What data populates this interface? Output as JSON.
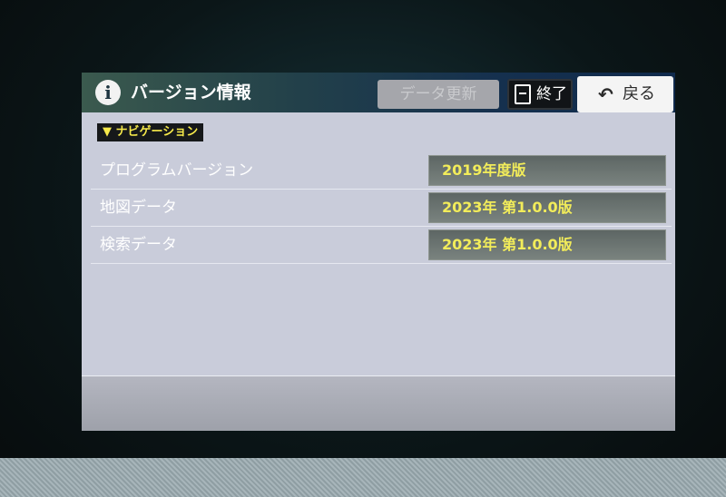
{
  "header": {
    "title": "バージョン情報",
    "info_icon": "info-icon",
    "update_button": "データ更新",
    "end_button": "終了",
    "end_icon": "exit-door-icon",
    "back_button": "戻る",
    "back_icon": "back-arrow-icon",
    "back_glyph": "↶"
  },
  "section": {
    "marker": "▼",
    "title": "ナビゲーション"
  },
  "rows": [
    {
      "label": "プログラムバージョン",
      "value": "2019年度版"
    },
    {
      "label": "地図データ",
      "value": "2023年 第1.0.0版"
    },
    {
      "label": "検索データ",
      "value": "2023年 第1.0.0版"
    }
  ],
  "colors": {
    "value_text": "#f2ec5a",
    "section_text": "#f6e94a",
    "panel_bg": "#c9ccda",
    "title_bar": "#15304e"
  }
}
